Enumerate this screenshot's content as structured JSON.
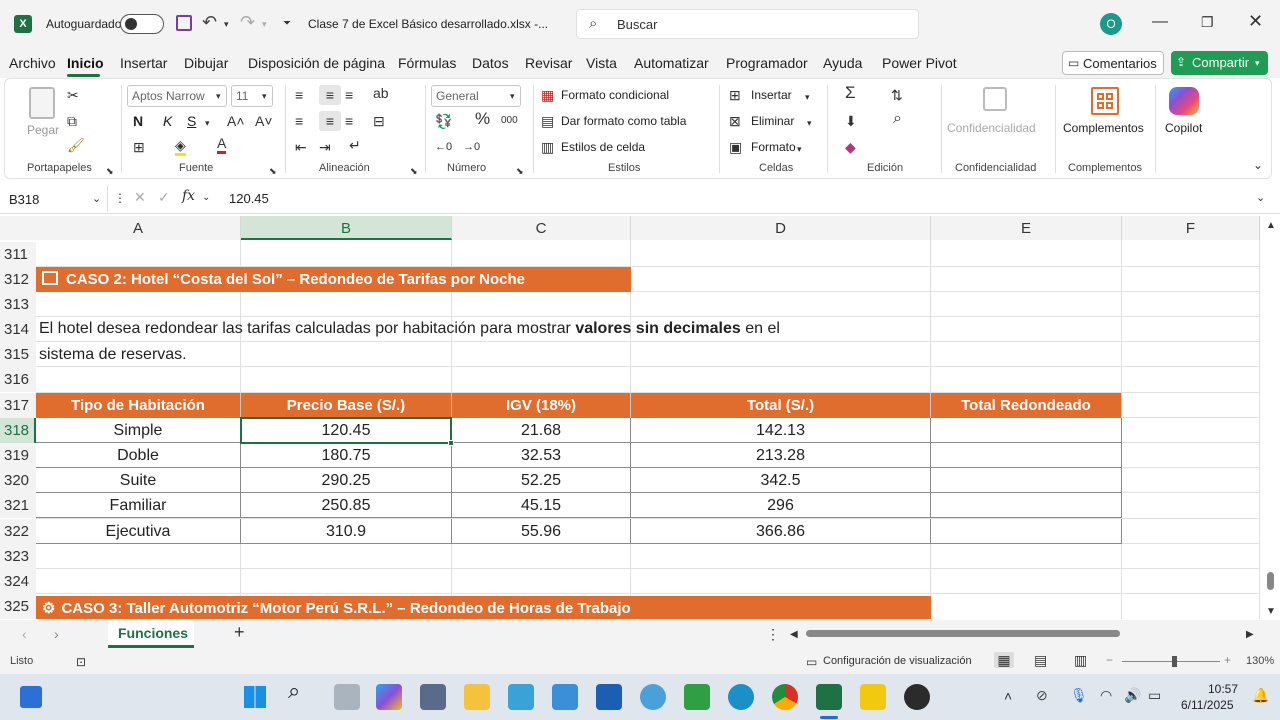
{
  "titlebar": {
    "autosave_label": "Autoguardado",
    "filename": "Clase 7 de Excel Básico desarrollado.xlsx  -...",
    "search_placeholder": "Buscar",
    "avatar_initial": "O"
  },
  "menu": {
    "items": [
      "Archivo",
      "Inicio",
      "Insertar",
      "Dibujar",
      "Disposición de página",
      "Fórmulas",
      "Datos",
      "Revisar",
      "Vista",
      "Automatizar",
      "Programador",
      "Ayuda",
      "Power Pivot"
    ],
    "active": "Inicio",
    "comments_label": "Comentarios",
    "share_label": "Compartir"
  },
  "ribbon": {
    "paste_label": "Pegar",
    "font_name": "Aptos Narrow",
    "font_size": "11",
    "number_format": "General",
    "bold": "N",
    "italic": "K",
    "underline": "S",
    "cond_format": "Formato condicional",
    "table_format": "Dar formato como tabla",
    "cell_styles": "Estilos de celda",
    "insert": "Insertar",
    "delete": "Eliminar",
    "format": "Formato",
    "sensitivity": "Confidencialidad",
    "addins": "Complementos",
    "copilot": "Copilot",
    "groups": {
      "clipboard": "Portapapeles",
      "font": "Fuente",
      "alignment": "Alineación",
      "number": "Número",
      "styles": "Estilos",
      "cells": "Celdas",
      "editing": "Edición",
      "sensitivity": "Confidencialidad",
      "addins": "Complementos"
    }
  },
  "formula_bar": {
    "name_box": "B318",
    "formula": "120.45"
  },
  "sheet": {
    "columns": [
      "A",
      "B",
      "C",
      "D",
      "E",
      "F"
    ],
    "rows": [
      "311",
      "312",
      "313",
      "314",
      "315",
      "316",
      "317",
      "318",
      "319",
      "320",
      "321",
      "322",
      "323",
      "324",
      "325"
    ],
    "case2_title": "CASO 2: Hotel “Costa del Sol” – Redondeo de Tarifas por Noche",
    "desc_part1": "El hotel desea redondear las tarifas calculadas por habitación para mostrar ",
    "desc_bold": "valores sin decimales",
    "desc_part2": " en el",
    "desc_line2": "sistema de reservas.",
    "headers": [
      "Tipo de Habitación",
      "Precio Base (S/.)",
      "IGV (18%)",
      "Total (S/.)",
      "Total Redondeado"
    ],
    "table": [
      [
        "Simple",
        "120.45",
        "21.68",
        "142.13",
        ""
      ],
      [
        "Doble",
        "180.75",
        "32.53",
        "213.28",
        ""
      ],
      [
        "Suite",
        "290.25",
        "52.25",
        "342.5",
        ""
      ],
      [
        "Familiar",
        "250.85",
        "45.15",
        "296",
        ""
      ],
      [
        "Ejecutiva",
        "310.9",
        "55.96",
        "366.86",
        ""
      ]
    ],
    "case3_title": "CASO 3: Taller Automotriz “Motor Perú S.R.L.” – Redondeo de Horas de Trabajo"
  },
  "sheet_tabs": {
    "active_tab": "Funciones"
  },
  "status": {
    "ready": "Listo",
    "view_settings": "Configuración de visualización",
    "zoom": "130%"
  },
  "taskbar": {
    "time": "10:57",
    "date": "6/11/2025"
  },
  "colors": {
    "accent_orange": "#e06c2e",
    "excel_green": "#1e7145",
    "share_green": "#1f9d55"
  }
}
